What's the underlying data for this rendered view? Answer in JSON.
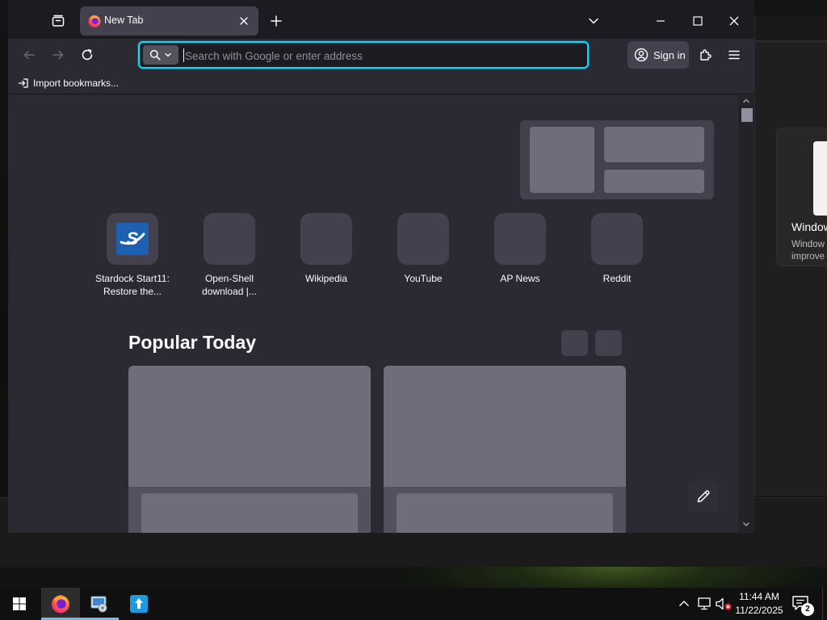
{
  "browser": {
    "tab": {
      "title": "New Tab"
    },
    "urlbar": {
      "placeholder": "Search with Google or enter address"
    },
    "signin_label": "Sign in",
    "bookmarks": {
      "import_label": "Import bookmarks..."
    }
  },
  "newtab": {
    "shortcuts": [
      {
        "label": "Stardock Start11:\nRestore the..."
      },
      {
        "label": "Open-Shell\ndownload |..."
      },
      {
        "label": "Wikipedia"
      },
      {
        "label": "YouTube"
      },
      {
        "label": "AP News"
      },
      {
        "label": "Reddit"
      }
    ],
    "popular_title": "Popular Today"
  },
  "background_window": {
    "notification_title": "Window",
    "notification_body": "Window\nimprove"
  },
  "taskbar": {
    "apps": [
      {
        "icon": "firefox-icon",
        "active": true
      },
      {
        "icon": "control-panel-icon",
        "active": false
      },
      {
        "icon": "app-upload-icon",
        "active": false
      }
    ],
    "clock": {
      "time": "11:44 AM",
      "date": "11/22/2025"
    },
    "notification_count": "2"
  },
  "colors": {
    "accent_focus": "#00ddff",
    "toolbar_bg": "#2b2a33",
    "tabstrip_bg": "#1c1b22",
    "tile_bg": "#42414d",
    "placeholder_gray": "#6e6d7a",
    "taskbar_bg": "#101010",
    "taskbar_active_underline": "#76b9ed"
  }
}
